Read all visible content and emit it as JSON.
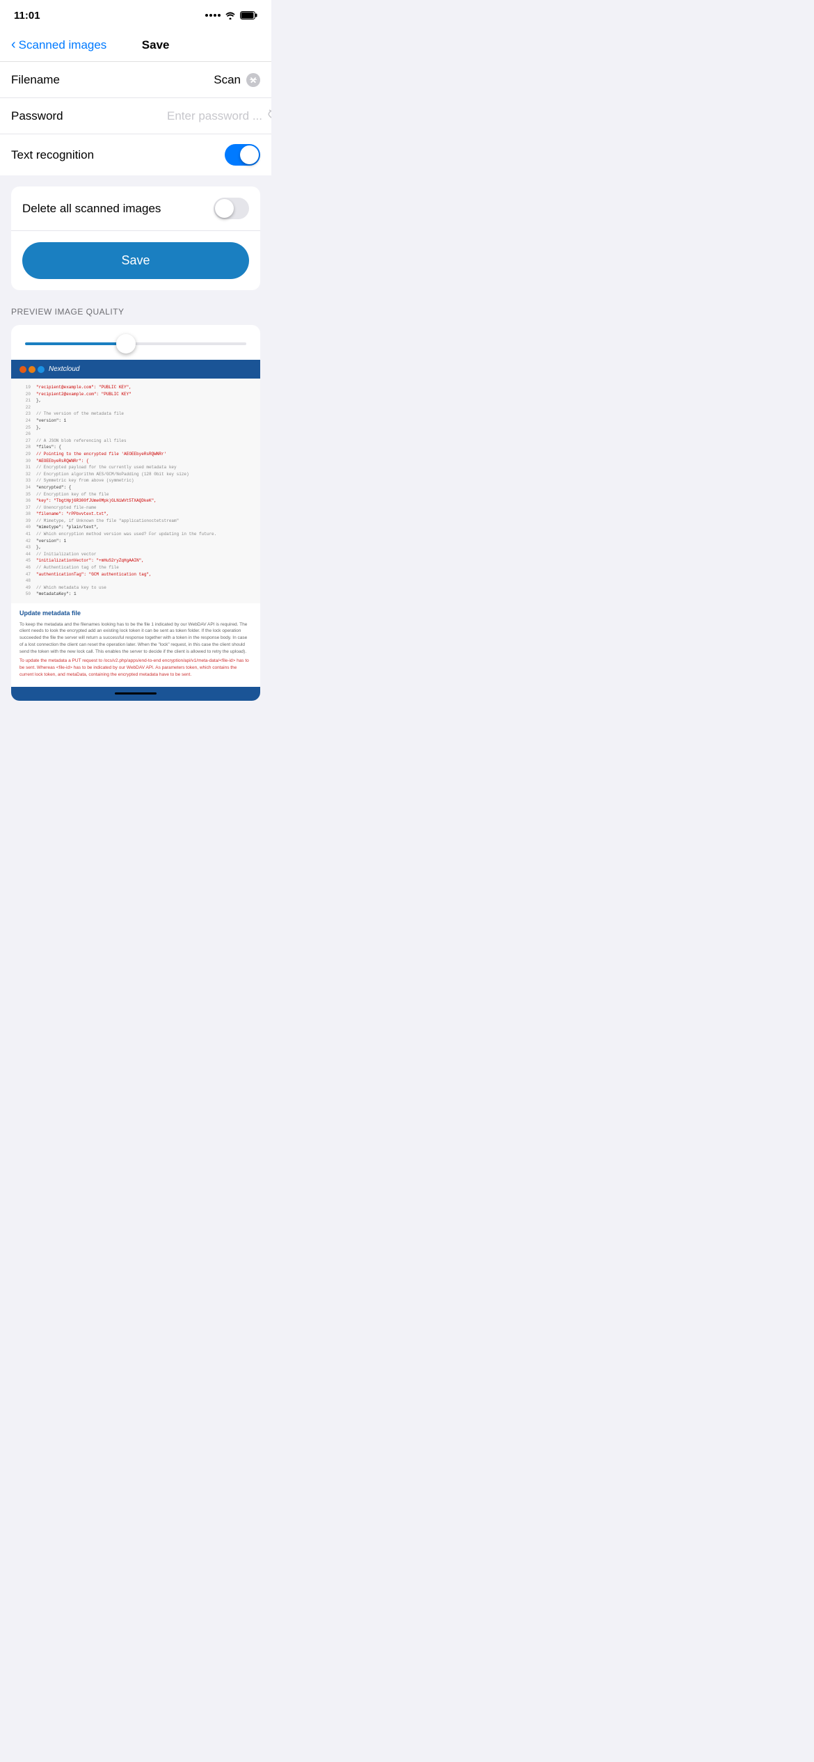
{
  "status_bar": {
    "time": "11:01",
    "dots": [
      "dot",
      "dot",
      "dot",
      "dot"
    ],
    "wifi": "wifi",
    "battery": "battery"
  },
  "nav": {
    "back_label": "Scanned images",
    "title": "Save"
  },
  "form": {
    "filename_label": "Filename",
    "filename_value": "Scan",
    "password_label": "Password",
    "password_placeholder": "Enter password ...",
    "text_recognition_label": "Text recognition",
    "text_recognition_enabled": true
  },
  "actions": {
    "delete_label": "Delete all scanned images",
    "delete_enabled": false,
    "save_button": "Save"
  },
  "preview": {
    "section_label": "PREVIEW IMAGE QUALITY",
    "slider_value": 45
  },
  "code_lines": [
    {
      "num": "19",
      "code": "\"recipient@example.com\": \"PUBLIC KEY\",",
      "style": "red"
    },
    {
      "num": "20",
      "code": "\"recipient2@example.com\": \"PUBLIC KEY\"",
      "style": "red"
    },
    {
      "num": "21",
      "code": "},",
      "style": ""
    },
    {
      "num": "22",
      "code": "",
      "style": ""
    },
    {
      "num": "23",
      "code": "// The version of the metadata file",
      "style": "comment"
    },
    {
      "num": "24",
      "code": "\"version\": 1",
      "style": ""
    },
    {
      "num": "25",
      "code": "},",
      "style": ""
    },
    {
      "num": "26",
      "code": "",
      "style": ""
    },
    {
      "num": "27",
      "code": "// A JSON blob referencing all files",
      "style": "comment"
    },
    {
      "num": "28",
      "code": "\"files\": {",
      "style": ""
    },
    {
      "num": "29",
      "code": "// Pointing to the encrypted file 'AEOEEbyeRsRQWNRr'",
      "style": "red"
    },
    {
      "num": "30",
      "code": "\"AEOEEbyeRsRQWNRr\": {",
      "style": "red"
    },
    {
      "num": "31",
      "code": "// Encrypted payload for the currently used metadata key",
      "style": "comment"
    },
    {
      "num": "32",
      "code": "// Encryption algorithm AES/GCM/NoPadding (128 0bit key size)",
      "style": "comment"
    },
    {
      "num": "33",
      "code": "// Symmetric key from above (symmetric)",
      "style": "comment"
    },
    {
      "num": "34",
      "code": "\"encrypted\": {",
      "style": ""
    },
    {
      "num": "35",
      "code": "// Encryption key of the file",
      "style": "comment"
    },
    {
      "num": "36",
      "code": "\"key\": \"TbgtHpj6R300fJUme0Mpk)GLNiWVt5TXAQDkeK\",",
      "style": "red"
    },
    {
      "num": "37",
      "code": "// Unencrypted file-name",
      "style": "comment"
    },
    {
      "num": "38",
      "code": "\"filename\": \"rPPbvvtext.txt\",",
      "style": "red"
    },
    {
      "num": "39",
      "code": "// Mimetype, if Unknown the file \"applicationoctetstream\"",
      "style": "comment"
    },
    {
      "num": "40",
      "code": "\"mimetype\": \"plain/text\",",
      "style": ""
    },
    {
      "num": "41",
      "code": "// Which encryption method version was used? For updating in the future.",
      "style": "comment"
    },
    {
      "num": "42",
      "code": "\"version\": 1",
      "style": ""
    },
    {
      "num": "43",
      "code": "},",
      "style": ""
    },
    {
      "num": "44",
      "code": "// Initialization vector",
      "style": "comment"
    },
    {
      "num": "45",
      "code": "\"initializationVector\": \"+mHuS2ryZqHgAAIN\",",
      "style": "red"
    },
    {
      "num": "46",
      "code": "// Authentication tag of the file",
      "style": "comment"
    },
    {
      "num": "47",
      "code": "\"authenticationTag\": \"GCM authentication tag\",",
      "style": "red"
    },
    {
      "num": "48",
      "code": "",
      "style": ""
    },
    {
      "num": "49",
      "code": "// Which metadata key to use",
      "style": "comment"
    },
    {
      "num": "50",
      "code": "\"metadataKey\": 1",
      "style": ""
    }
  ],
  "text_sections": [
    {
      "heading": "Update metadata file",
      "paragraphs": [
        {
          "text": "To keep the metadata and the filenames looking has to be the file 1 indicated by our WebDAV API is required. The client needs to look the encrypted add an existing lock token it can be sent as token folder. If the lock operation succeeded the file the server will return a successful response together with a token in the response body. In case of a lost connection the client can reset the operation later. When the \"lock\" request, in this case the client should send the token with the new lock call. This enables the server to decide if the client is allowed to retry the upload).",
          "style": "normal"
        },
        {
          "text": "To update the metadata a PUT request to /ocs/v2.php/apps/end-to-end encryption/api/v1/meta-data/<file-id> has to be sent. Whereas <file-id> has to be indicated by our WebDAV API. As parameters token, which contains the current lock token, and metaData, containing the encrypted metadata have to be sent.",
          "style": "red"
        }
      ]
    }
  ],
  "nextcloud": {
    "brand": "Nextcloud"
  }
}
